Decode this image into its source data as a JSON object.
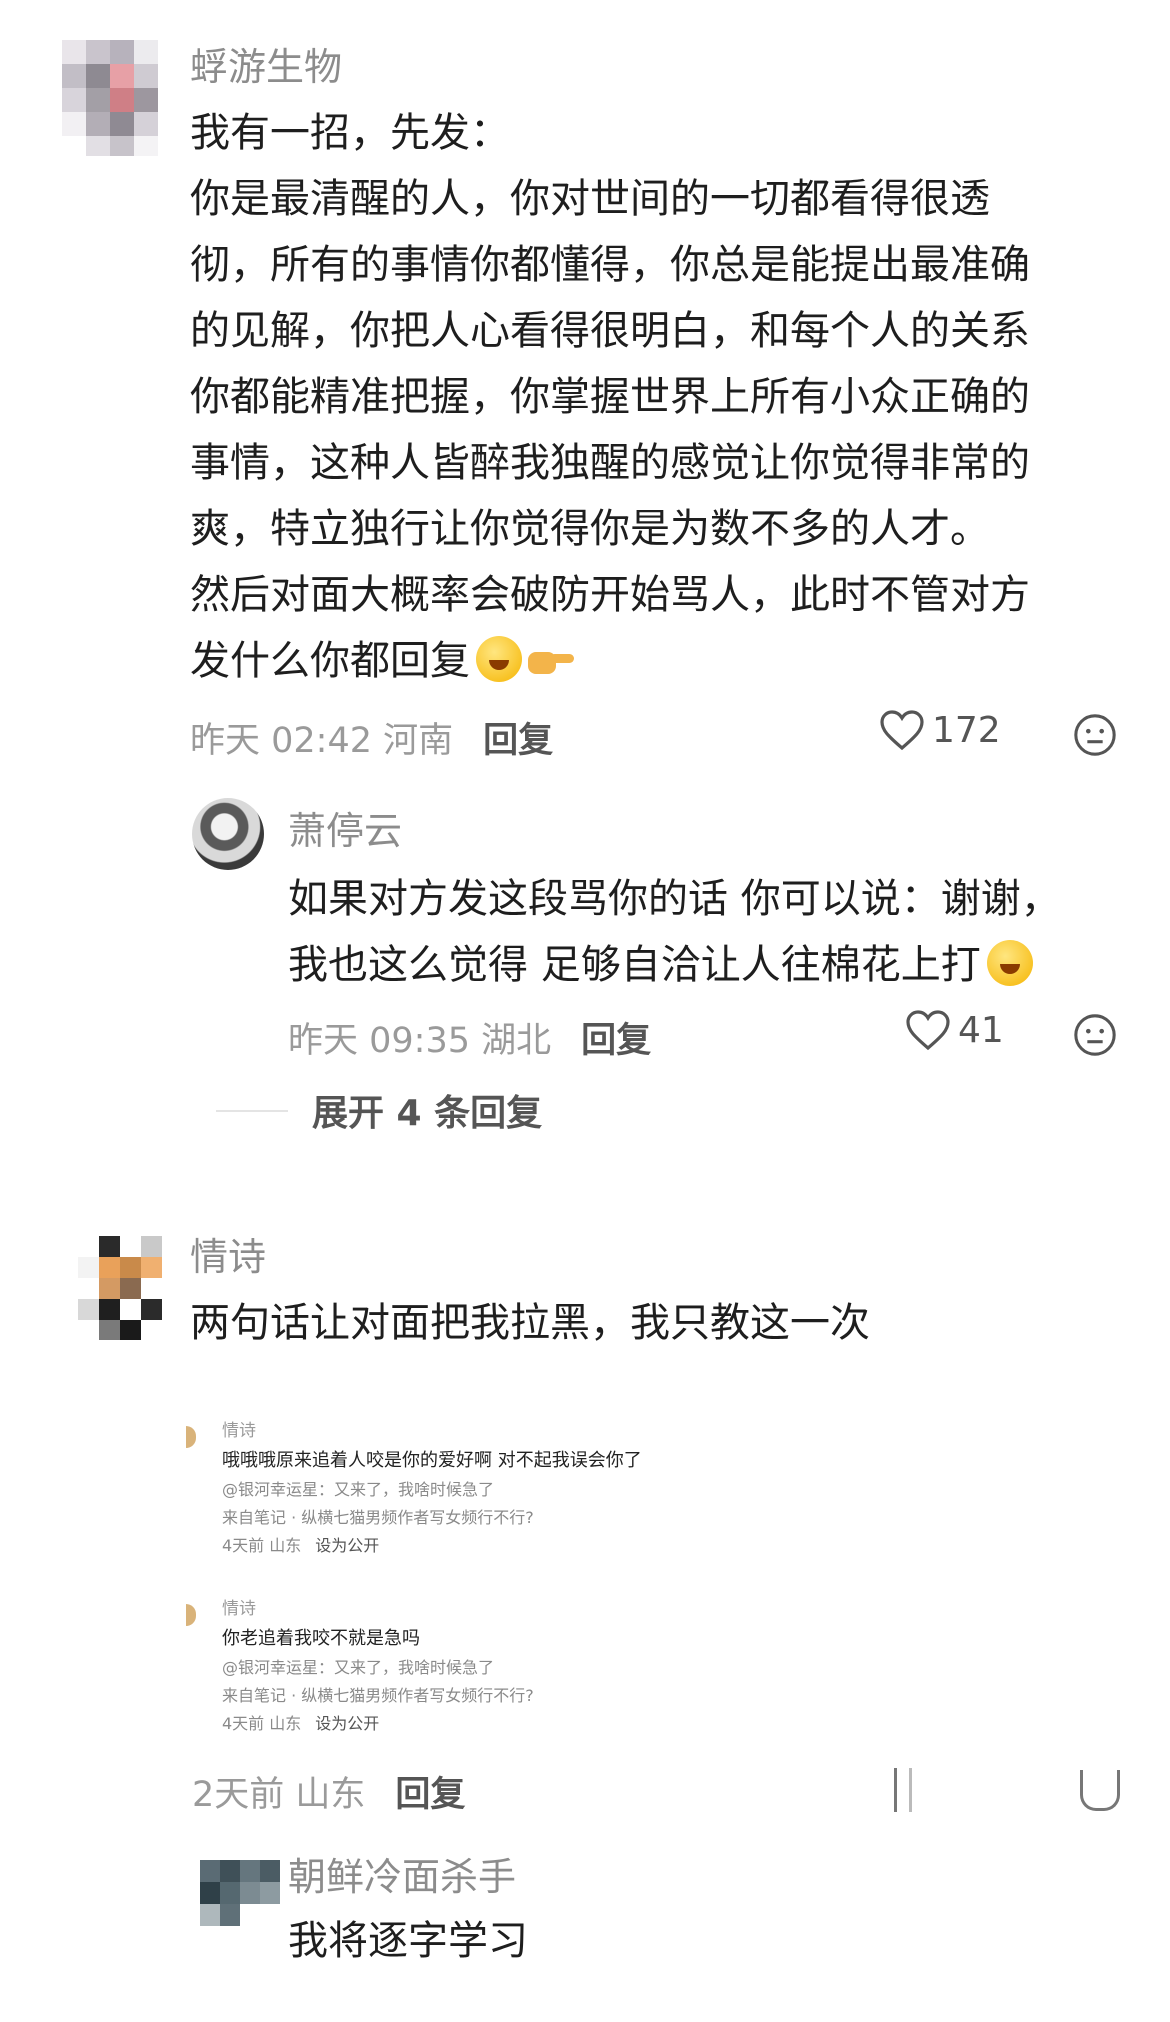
{
  "comments": [
    {
      "user": "蜉游生物",
      "lines": [
        "我有一招，先发：",
        "你是最清醒的人，你对世间的一切都看得很透",
        "彻，所有的事情你都懂得，你总是能提出最准确",
        "的见解，你把人心看得很明白，和每个人的关系",
        "你都能精准把握，你掌握世界上所有小众正确的",
        "事情，这种人皆醉我独醒的感觉让你觉得非常的",
        "爽，特立独行让你觉得你是为数不多的人才。",
        "然后对面大概率会破防开始骂人，此时不管对方",
        "发什么你都回复"
      ],
      "emoji_icons": [
        "rofl-emoji",
        "pointing-hand-emoji"
      ],
      "time": "昨天 02:42 河南",
      "reply_label": "回复",
      "likes": "172"
    },
    {
      "user": "萧停云",
      "lines": [
        "如果对方发这段骂你的话 你可以说：谢谢，",
        "我也这么觉得 足够自洽让人往棉花上打"
      ],
      "emoji_icons": [
        "rofl-emoji"
      ],
      "time": "昨天 09:35 湖北",
      "reply_label": "回复",
      "likes": "41",
      "expand_label": "展开 4 条回复"
    },
    {
      "user": "情诗",
      "text": "两句话让对面把我拉黑，我只教这一次",
      "screenshots": [
        {
          "user": "情诗",
          "text": "哦哦哦原来追着人咬是你的爱好啊 对不起我误会你了",
          "quote": "@银河幸运星：又来了，我啥时候急了",
          "source": "来自笔记 · 纵横七猫男频作者写女频行不行?",
          "time": "4天前 山东",
          "action": "设为公开"
        },
        {
          "user": "情诗",
          "text": "你老追着我咬不就是急吗",
          "quote": "@银河幸运星：又来了，我啥时候急了",
          "source": "来自笔记 · 纵横七猫男频作者写女频行不行?",
          "time": "4天前 山东",
          "action": "设为公开"
        }
      ],
      "time": "2天前 山东",
      "reply_label": "回复"
    },
    {
      "user": "朝鲜冷面杀手",
      "text": "我将逐字学习"
    }
  ]
}
